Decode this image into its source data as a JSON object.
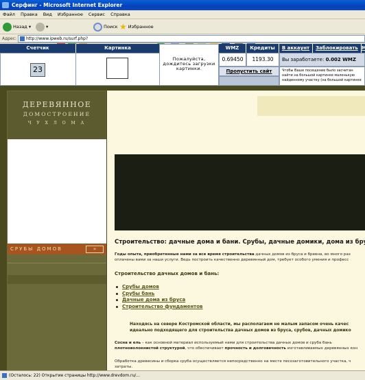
{
  "window": {
    "title": "Серфинг - Microsoft Internet Explorer"
  },
  "menu": [
    "Файл",
    "Правка",
    "Вид",
    "Избранное",
    "Сервис",
    "Справка"
  ],
  "toolbar": {
    "back": "Назад",
    "search": "Поиск",
    "favorites": "Избранное"
  },
  "address": {
    "label": "Адрес:",
    "url": "http://www.ipweb.ru/surf.php?"
  },
  "surf": {
    "headers": {
      "counter": "Счетчик",
      "picture": "Картинка",
      "wmz": "WMZ",
      "credits": "Кредиты",
      "account": "В аккаунт",
      "block": "Заблокировать",
      "more": "М"
    },
    "counter_value": "23",
    "wait_text": [
      "Пожалуйста,",
      "дождитесь загрузки",
      "картинки."
    ],
    "wmz_value": "0.69450",
    "credits_value": "1193.30",
    "skip_button": "Пропустить сайт",
    "earned_text": "Вы заработаете:",
    "earned_value": "0.002 WMZ",
    "info_lines": [
      "Чтобы Ваше посещение было засчитан",
      "найти на большой картинке маленькую",
      "найденному участку (на большой картинке"
    ]
  },
  "site": {
    "logo_line1": "ДЕРЕВЯННОЕ",
    "logo_line2": "ДОМОСТРОЕНИЕ",
    "logo_line3": "Ч У Х Л О М А",
    "sruby_label": "СРУБЫ ДОМОВ",
    "sruby_arrow": "»",
    "heading": "Строительство: дачные дома и бани. Срубы, дачные домики, дома из бруса.",
    "intro_bold": "Годы опыта, приобретенные нами за все время строительства",
    "intro_rest": " дачных домов из бруса и бревна, во много раз",
    "intro_line2": "оплачены вами за наши услуги. Ведь построить качественно деревянный дом, требует особого умения и професс",
    "subheading": "Строительство дачных домов и бань:",
    "links": [
      "Срубы домов",
      "Срубы бань",
      "Дачные дома из бруса",
      "Строительство фундаментов"
    ],
    "bold_para_line1": "Находясь на севере Костромской области, мы располагаем не малым запасом очень качес",
    "bold_para_line2": "идеально подходящего для строительства дачных домов из бруса, срубов, дачных домико",
    "pine_bold": "Сосна и ель",
    "pine_rest": " – как основной материал используемый нами для строительства дачных домов и сруба бань",
    "pine_line2_bold": "плотноволокнистой структурой",
    "pine_line2_rest": ", что обеспечивает ",
    "pine_line2_bold2": "прочность и долговечность",
    "pine_line2_end": " изготавливаемых деревянных кон",
    "last_line1": "Обработка древесины и сборка сруба осуществляется непосредственно на месте песозаготовительного участка, ч",
    "last_line2": "затраты."
  },
  "status": {
    "text": "(Осталось: 22) Открытие страницы http://www.drevdom.ru/..."
  }
}
